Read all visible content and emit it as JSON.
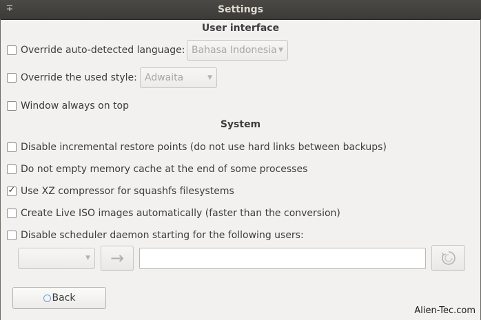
{
  "window": {
    "title": "Settings",
    "pin_glyph": "∓"
  },
  "sections": {
    "user_interface": "User interface",
    "system": "System"
  },
  "options": {
    "override_language": {
      "label": "Override auto-detected language:",
      "checked": false
    },
    "override_style": {
      "label": "Override the used style:",
      "checked": false
    },
    "always_on_top": {
      "label": "Window always on top",
      "checked": false
    },
    "disable_restore_points": {
      "label": "Disable incremental restore points (do not use hard links between backups)",
      "checked": false
    },
    "no_empty_cache": {
      "label": "Do not empty memory cache at the end of some processes",
      "checked": false
    },
    "xz_compressor": {
      "label": "Use XZ compressor for squashfs filesystems",
      "checked": true,
      "mark": "✓"
    },
    "live_iso_auto": {
      "label": "Create Live ISO images automatically (faster than the conversion)",
      "checked": false
    },
    "disable_scheduler": {
      "label": "Disable scheduler daemon starting for the following users:",
      "checked": false
    }
  },
  "combos": {
    "language": {
      "value": "Bahasa Indonesia"
    },
    "style": {
      "value": "Adwaita"
    },
    "users": {
      "value": ""
    }
  },
  "icons": {
    "combo_arrow": "▼",
    "add_arrow": "→",
    "refresh": "refresh-icon",
    "back": "back-icon"
  },
  "users_entry": {
    "value": ""
  },
  "buttons": {
    "back": "Back"
  },
  "watermark": "Alien-Tec.com"
}
